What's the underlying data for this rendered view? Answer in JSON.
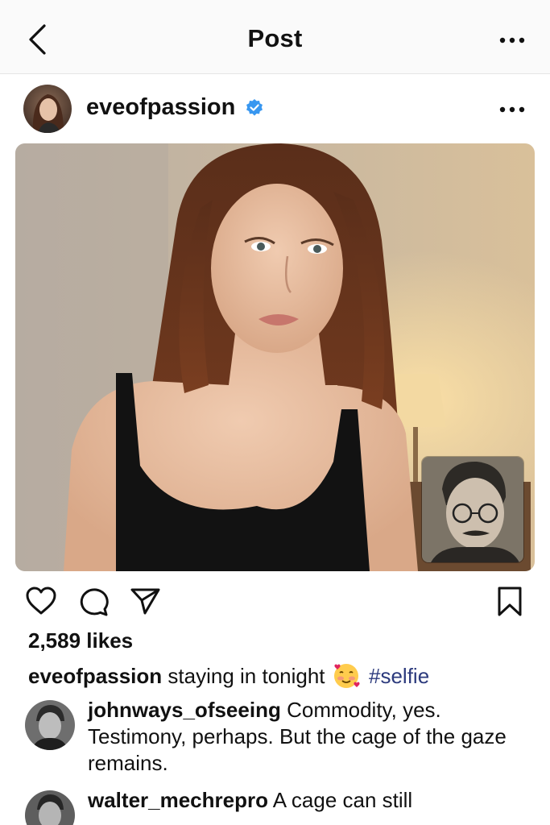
{
  "topbar": {
    "title": "Post",
    "back_icon": "chevron-left-icon",
    "more_icon": "more-horizontal-icon"
  },
  "post": {
    "username": "eveofpassion",
    "verified_icon": "verified-badge-icon",
    "likes": "2,589 likes",
    "caption_text": "staying in tonight",
    "caption_emoji": "smiling-face-with-hearts-emoji",
    "hashtag": "#selfie"
  },
  "comments": [
    {
      "username": "johnways_ofseeing",
      "text": "Commodity, yes. Testimony, perhaps. But the cage of the gaze remains."
    },
    {
      "username": "walter_mechrepro",
      "text": "A cage can still"
    }
  ],
  "colors": {
    "verified": "#3897f0",
    "hashtag": "#2c3a7d",
    "divider": "#e6e6e6"
  }
}
